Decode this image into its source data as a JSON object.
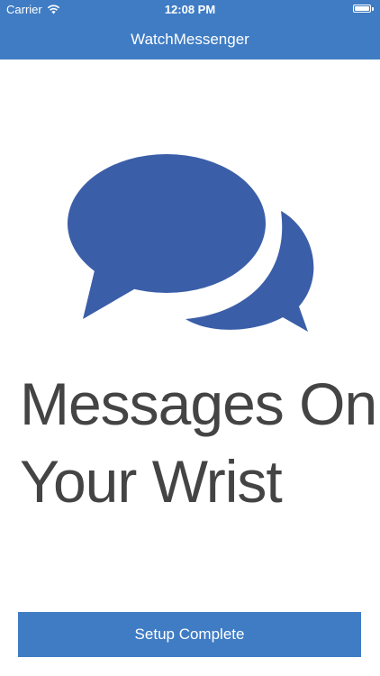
{
  "status_bar": {
    "carrier": "Carrier",
    "time": "12:08 PM"
  },
  "nav_bar": {
    "title": "WatchMessenger"
  },
  "hero": {
    "icon": "chat-bubbles-icon",
    "line1": "Messages On",
    "line2": "Your Wrist"
  },
  "actions": {
    "setup_label": "Setup Complete"
  },
  "colors": {
    "accent": "#3f7cc4",
    "bubble": "#3b5ea8",
    "text": "#444444"
  }
}
